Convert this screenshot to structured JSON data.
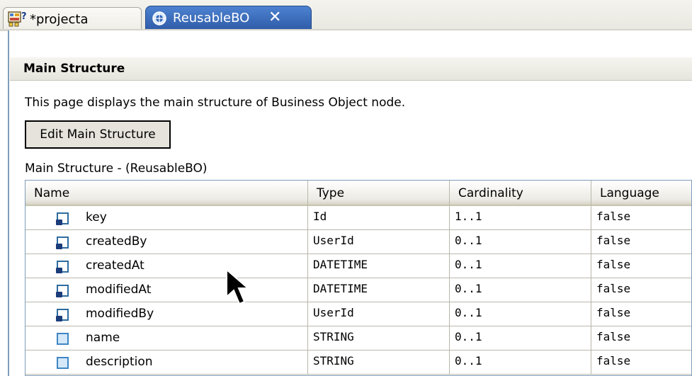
{
  "tabs": [
    {
      "label": "*projecta",
      "icon": "project-diagram-icon",
      "active": false
    },
    {
      "label": "ReusableBO",
      "icon": "business-object-icon",
      "active": true,
      "close": "✕"
    }
  ],
  "section": {
    "title": "Main Structure"
  },
  "description": "This page displays the main structure of Business Object node.",
  "edit_button": "Edit Main Structure",
  "table_caption": "Main Structure - (ReusableBO)",
  "table": {
    "columns": [
      "Name",
      "Type",
      "Cardinality",
      "Language"
    ],
    "rows": [
      {
        "name": "key",
        "type": "Id",
        "cardinality": "1..1",
        "language": "false",
        "icon": "key-attribute-icon"
      },
      {
        "name": "createdBy",
        "type": "UserId",
        "cardinality": "0..1",
        "language": "false",
        "icon": "key-attribute-icon"
      },
      {
        "name": "createdAt",
        "type": "DATETIME",
        "cardinality": "0..1",
        "language": "false",
        "icon": "key-attribute-icon"
      },
      {
        "name": "modifiedAt",
        "type": "DATETIME",
        "cardinality": "0..1",
        "language": "false",
        "icon": "key-attribute-icon"
      },
      {
        "name": "modifiedBy",
        "type": "UserId",
        "cardinality": "0..1",
        "language": "false",
        "icon": "key-attribute-icon"
      },
      {
        "name": "name",
        "type": "STRING",
        "cardinality": "0..1",
        "language": "false",
        "icon": "attribute-icon"
      },
      {
        "name": "description",
        "type": "STRING",
        "cardinality": "0..1",
        "language": "false",
        "icon": "attribute-icon"
      }
    ]
  },
  "colors": {
    "active_tab": "#3a6bbf",
    "border": "#7f9db9",
    "header_bg": "#ecebe4"
  }
}
